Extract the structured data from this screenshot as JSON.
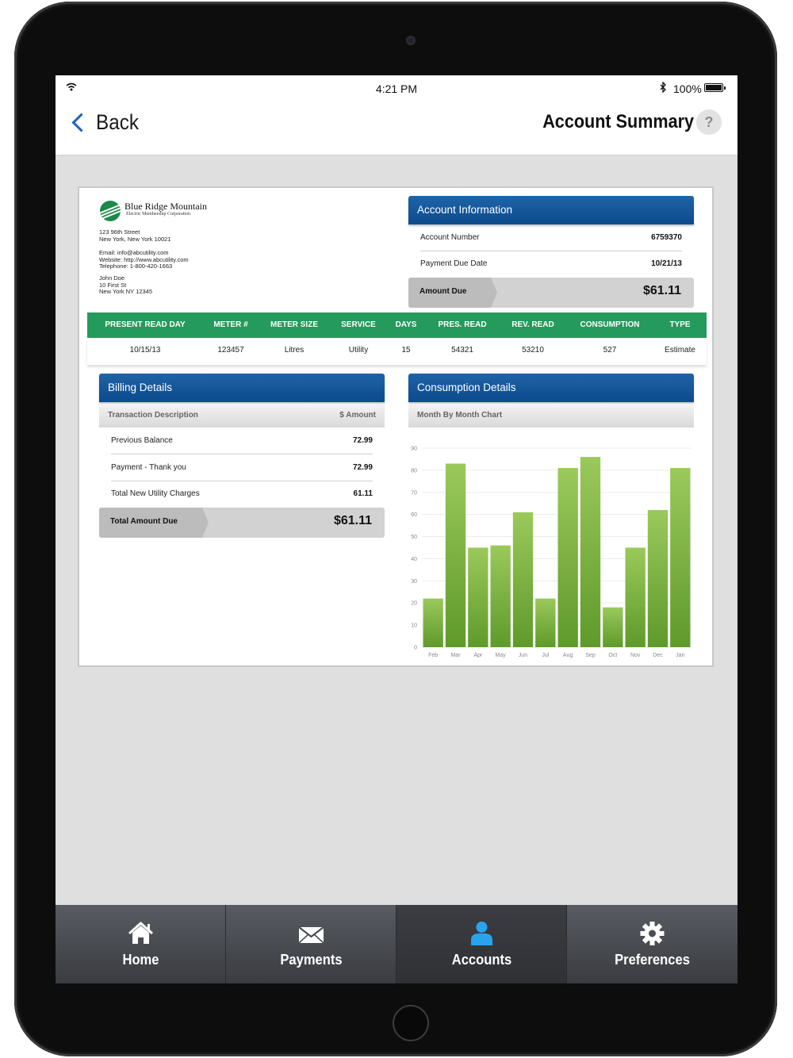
{
  "status_bar": {
    "time": "4:21 PM",
    "battery": "100%"
  },
  "nav": {
    "back_label": "Back",
    "title": "Account Summary",
    "help": "?"
  },
  "company": {
    "name": "Blue Ridge Mountain",
    "subtitle": "Electric Membership Corporation",
    "address_lines": [
      "123 96th Street",
      "New York, New York 10021"
    ],
    "contact_lines": [
      "Email: info@abcutility.com",
      "Website: http://www.abcutility.com",
      "Telephone: 1-800-420-1663"
    ],
    "customer_lines": [
      "John Doe",
      "10 First St",
      "New York NY 12345"
    ]
  },
  "account_info": {
    "title": "Account Information",
    "account_number_label": "Account Number",
    "account_number": "6759370",
    "due_date_label": "Payment Due Date",
    "due_date": "10/21/13",
    "amount_due_label": "Amount Due",
    "amount_due": "$61.11"
  },
  "meter_table": {
    "headers": [
      "PRESENT READ DAY",
      "METER #",
      "METER SIZE",
      "SERVICE",
      "DAYS",
      "PRES. READ",
      "REV. READ",
      "CONSUMPTION",
      "TYPE"
    ],
    "row": [
      "10/15/13",
      "123457",
      "Litres",
      "Utility",
      "15",
      "54321",
      "53210",
      "527",
      "Estimate"
    ]
  },
  "billing": {
    "title": "Billing Details",
    "col_desc": "Transaction Description",
    "col_amount": "$ Amount",
    "rows": [
      {
        "label": "Previous Balance",
        "amount": "72.99"
      },
      {
        "label": "Payment - Thank you",
        "amount": "72.99"
      },
      {
        "label": "Total New Utility Charges",
        "amount": "61.11"
      }
    ],
    "total_label": "Total Amount Due",
    "total": "$61.11"
  },
  "consumption": {
    "title": "Consumption Details",
    "subtitle": "Month By Month Chart"
  },
  "chart_data": {
    "type": "bar",
    "categories": [
      "Feb",
      "Mar",
      "Apr",
      "May",
      "Jun",
      "Jul",
      "Aug",
      "Sep",
      "Oct",
      "Nov",
      "Dec",
      "Jan"
    ],
    "values": [
      22,
      83,
      45,
      46,
      61,
      22,
      81,
      86,
      18,
      45,
      62,
      81
    ],
    "ylim": [
      0,
      90
    ],
    "yticks": [
      0,
      10,
      20,
      30,
      40,
      50,
      60,
      70,
      80,
      90
    ],
    "grid": true,
    "bar_color_top": "#9bc95b",
    "bar_color_bottom": "#5e9a2a"
  },
  "tabs": [
    {
      "label": "Home",
      "icon": "home-icon"
    },
    {
      "label": "Payments",
      "icon": "envelope-icon"
    },
    {
      "label": "Accounts",
      "icon": "user-icon",
      "active": true
    },
    {
      "label": "Preferences",
      "icon": "gear-icon"
    }
  ],
  "colors": {
    "accent_blue": "#1e63c6",
    "header_blue": "#0c4a8c",
    "meter_green": "#249a5c",
    "active_tab_icon": "#2aa3ef"
  }
}
